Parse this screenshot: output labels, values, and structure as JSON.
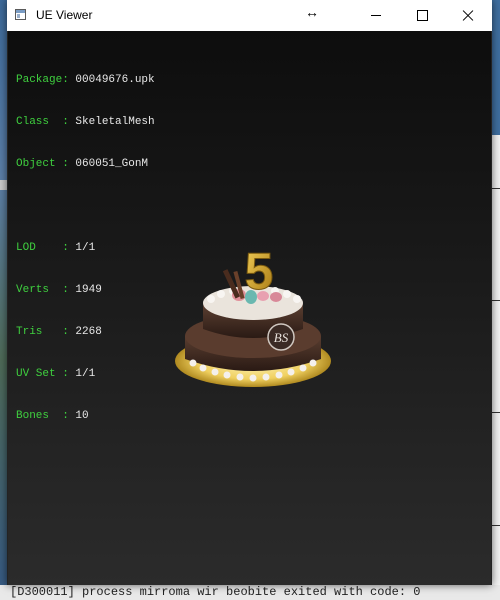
{
  "window": {
    "title": "UE Viewer"
  },
  "info": {
    "package": {
      "key": "Package: ",
      "value": "00049676.upk"
    },
    "class": {
      "key": "Class  : ",
      "value": "SkeletalMesh"
    },
    "object": {
      "key": "Object : ",
      "value": "060051_GonM"
    },
    "lod": {
      "key": "LOD    : ",
      "value": "1/1"
    },
    "verts": {
      "key": "Verts  : ",
      "value": "1949"
    },
    "tris": {
      "key": "Tris   : ",
      "value": "2268"
    },
    "uvset": {
      "key": "UV Set : ",
      "value": "1/1"
    },
    "bones": {
      "key": "Bones  : ",
      "value": "10"
    }
  },
  "model": {
    "candle_number": "5",
    "emblem": "BS"
  },
  "background": {
    "terminal_line": "[D300011] process  mirroma wir beobite  exited with code: 0"
  },
  "colors": {
    "label_green": "#3fd03f",
    "value_white": "#e8e8e8",
    "candle_gold": "#d8a520"
  }
}
